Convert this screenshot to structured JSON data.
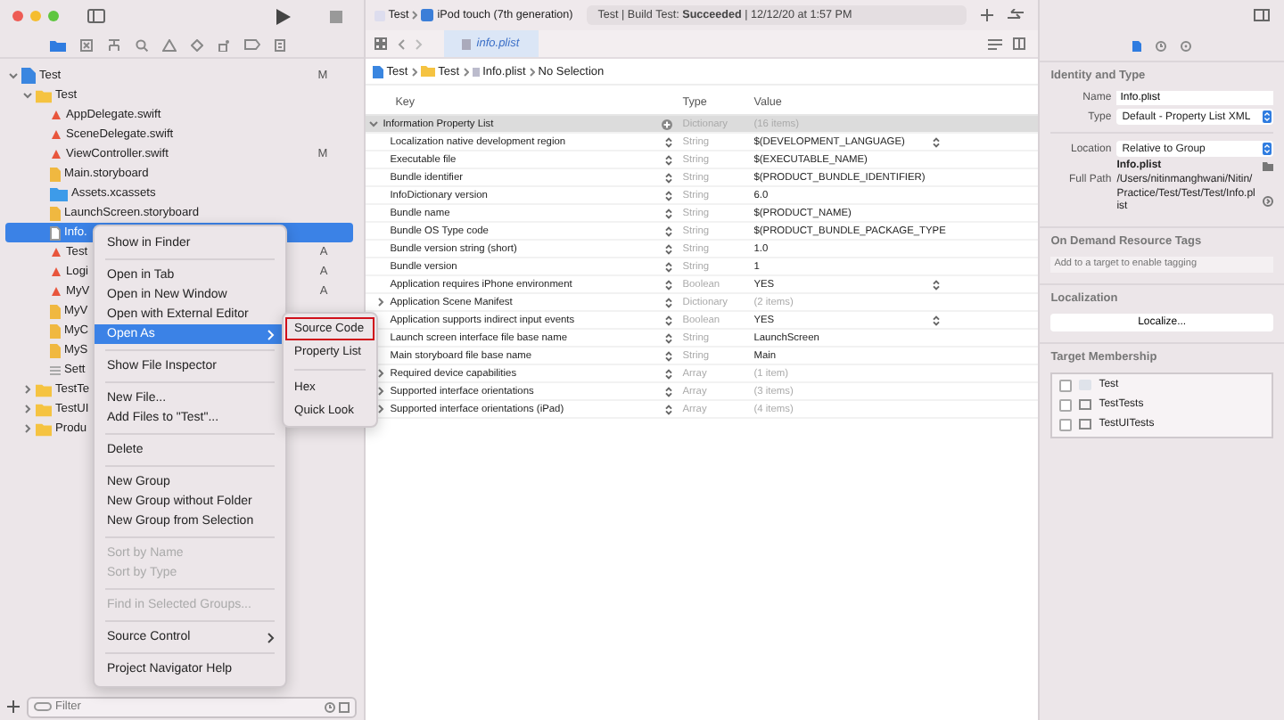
{
  "navigator": {
    "tree": [
      {
        "name": "Test",
        "kind": "project",
        "status": "M",
        "expanded": true,
        "selected": false,
        "children": [
          {
            "name": "Test",
            "kind": "folder",
            "expanded": true,
            "selected": false,
            "children": [
              {
                "name": "AppDelegate.swift",
                "kind": "swift",
                "selected": false
              },
              {
                "name": "SceneDelegate.swift",
                "kind": "swift",
                "selected": false
              },
              {
                "name": "ViewController.swift",
                "kind": "swift",
                "status": "M",
                "selected": false
              },
              {
                "name": "Main.storyboard",
                "kind": "storyboard",
                "selected": false
              },
              {
                "name": "Assets.xcassets",
                "kind": "assets",
                "selected": false
              },
              {
                "name": "LaunchScreen.storyboard",
                "kind": "storyboard",
                "selected": false
              },
              {
                "name": "Info.",
                "kind": "plist",
                "selected": true
              },
              {
                "name": "Test",
                "kind": "swift",
                "status": "A",
                "selected": false
              },
              {
                "name": "Logi",
                "kind": "swift",
                "status": "A",
                "selected": false
              },
              {
                "name": "MyV",
                "kind": "swift",
                "status": "A",
                "selected": false
              },
              {
                "name": "MyV",
                "kind": "storyboard",
                "selected": false
              },
              {
                "name": "MyC",
                "kind": "storyboard",
                "selected": false
              },
              {
                "name": "MyS",
                "kind": "storyboard",
                "selected": false
              },
              {
                "name": "Sett",
                "kind": "settings",
                "selected": false
              }
            ]
          },
          {
            "name": "TestTe",
            "kind": "folder",
            "expanded": false,
            "selected": false
          },
          {
            "name": "TestUI",
            "kind": "folder",
            "expanded": false,
            "selected": false
          },
          {
            "name": "Produ",
            "kind": "folder",
            "expanded": false,
            "selected": false
          }
        ]
      }
    ],
    "filter": {
      "placeholder": "Filter"
    }
  },
  "context_menu": {
    "groups": [
      [
        {
          "label": "Show in Finder",
          "disabled": false,
          "selected": false,
          "submenu": false
        }
      ],
      [
        {
          "label": "Open in Tab",
          "disabled": false,
          "selected": false,
          "submenu": false
        },
        {
          "label": "Open in New Window",
          "disabled": false,
          "selected": false,
          "submenu": false
        },
        {
          "label": "Open with External Editor",
          "disabled": false,
          "selected": false,
          "submenu": false
        },
        {
          "label": "Open As",
          "disabled": false,
          "selected": true,
          "submenu": true
        }
      ],
      [
        {
          "label": "Show File Inspector",
          "disabled": false,
          "selected": false,
          "submenu": false
        }
      ],
      [
        {
          "label": "New File...",
          "disabled": false,
          "selected": false,
          "submenu": false
        },
        {
          "label": "Add Files to \"Test\"...",
          "disabled": false,
          "selected": false,
          "submenu": false
        }
      ],
      [
        {
          "label": "Delete",
          "disabled": false,
          "selected": false,
          "submenu": false
        }
      ],
      [
        {
          "label": "New Group",
          "disabled": false,
          "selected": false,
          "submenu": false
        },
        {
          "label": "New Group without Folder",
          "disabled": false,
          "selected": false,
          "submenu": false
        },
        {
          "label": "New Group from Selection",
          "disabled": false,
          "selected": false,
          "submenu": false
        }
      ],
      [
        {
          "label": "Sort by Name",
          "disabled": true,
          "selected": false,
          "submenu": false
        },
        {
          "label": "Sort by Type",
          "disabled": true,
          "selected": false,
          "submenu": false
        }
      ],
      [
        {
          "label": "Find in Selected Groups...",
          "disabled": true,
          "selected": false,
          "submenu": false
        }
      ],
      [
        {
          "label": "Source Control",
          "disabled": false,
          "selected": false,
          "submenu": true
        }
      ],
      [
        {
          "label": "Project Navigator Help",
          "disabled": false,
          "selected": false,
          "submenu": false
        }
      ]
    ],
    "submenu": [
      [
        {
          "label": "Source Code",
          "highlighted": true
        },
        {
          "label": "Property List",
          "highlighted": false
        }
      ],
      [
        {
          "label": "Hex",
          "highlighted": false
        },
        {
          "label": "Quick Look",
          "highlighted": false
        }
      ]
    ]
  },
  "toolbar": {
    "scheme": "Test",
    "device": "iPod touch (7th generation)",
    "activity": "Test | Build Test: **Succeeded** | 12/12/20 at 1:57 PM"
  },
  "editor": {
    "tab": "info.plist",
    "breadcrumb": [
      "Test",
      "Test",
      "Info.plist",
      "No Selection"
    ],
    "columns": [
      "Key",
      "Type",
      "Value"
    ],
    "root": {
      "key": "Information Property List",
      "type": "Dictionary",
      "value": "(16 items)",
      "expanded": true
    },
    "rows": [
      {
        "key": "Localization native development region",
        "type": "String",
        "value": "$(DEVELOPMENT_LANGUAGE)",
        "expandable": false,
        "popup": true
      },
      {
        "key": "Executable file",
        "type": "String",
        "value": "$(EXECUTABLE_NAME)",
        "expandable": false,
        "popup": false
      },
      {
        "key": "Bundle identifier",
        "type": "String",
        "value": "$(PRODUCT_BUNDLE_IDENTIFIER)",
        "expandable": false,
        "popup": false
      },
      {
        "key": "InfoDictionary version",
        "type": "String",
        "value": "6.0",
        "expandable": false,
        "popup": false
      },
      {
        "key": "Bundle name",
        "type": "String",
        "value": "$(PRODUCT_NAME)",
        "expandable": false,
        "popup": false
      },
      {
        "key": "Bundle OS Type code",
        "type": "String",
        "value": "$(PRODUCT_BUNDLE_PACKAGE_TYPE",
        "expandable": false,
        "popup": false
      },
      {
        "key": "Bundle version string (short)",
        "type": "String",
        "value": "1.0",
        "expandable": false,
        "popup": false
      },
      {
        "key": "Bundle version",
        "type": "String",
        "value": "1",
        "expandable": false,
        "popup": false
      },
      {
        "key": "Application requires iPhone environment",
        "type": "Boolean",
        "value": "YES",
        "expandable": false,
        "popup": true
      },
      {
        "key": "Application Scene Manifest",
        "type": "Dictionary",
        "value": "(2 items)",
        "expandable": true,
        "popup": false
      },
      {
        "key": "Application supports indirect input events",
        "type": "Boolean",
        "value": "YES",
        "expandable": false,
        "popup": true
      },
      {
        "key": "Launch screen interface file base name",
        "type": "String",
        "value": "LaunchScreen",
        "expandable": false,
        "popup": false
      },
      {
        "key": "Main storyboard file base name",
        "type": "String",
        "value": "Main",
        "expandable": false,
        "popup": false
      },
      {
        "key": "Required device capabilities",
        "type": "Array",
        "value": "(1 item)",
        "expandable": true,
        "popup": false
      },
      {
        "key": "Supported interface orientations",
        "type": "Array",
        "value": "(3 items)",
        "expandable": true,
        "popup": false
      },
      {
        "key": "Supported interface orientations (iPad)",
        "type": "Array",
        "value": "(4 items)",
        "expandable": true,
        "popup": false
      }
    ]
  },
  "inspector": {
    "tabs": [
      {
        "kind": "file",
        "selected": true
      },
      {
        "kind": "history",
        "selected": false
      },
      {
        "kind": "help",
        "selected": false
      }
    ],
    "identity": {
      "title": "Identity and Type",
      "name_label": "Name",
      "name": "Info.plist",
      "type_label": "Type",
      "type": "Default - Property List XML",
      "location_label": "Location",
      "location": "Relative to Group",
      "location_file": "Info.plist",
      "full_path_label": "Full Path",
      "full_path": "/Users/nitinmanghwani/Nitin/Practice/Test/Test/Test/Info.plist"
    },
    "tags": {
      "title": "On Demand Resource Tags",
      "placeholder": "Add to a target to enable tagging"
    },
    "localization": {
      "title": "Localization",
      "button": "Localize..."
    },
    "membership": {
      "title": "Target Membership",
      "targets": [
        {
          "name": "Test",
          "kind": "app",
          "checked": false
        },
        {
          "name": "TestTests",
          "kind": "test",
          "checked": false
        },
        {
          "name": "TestUITests",
          "kind": "test",
          "checked": false
        }
      ]
    }
  }
}
